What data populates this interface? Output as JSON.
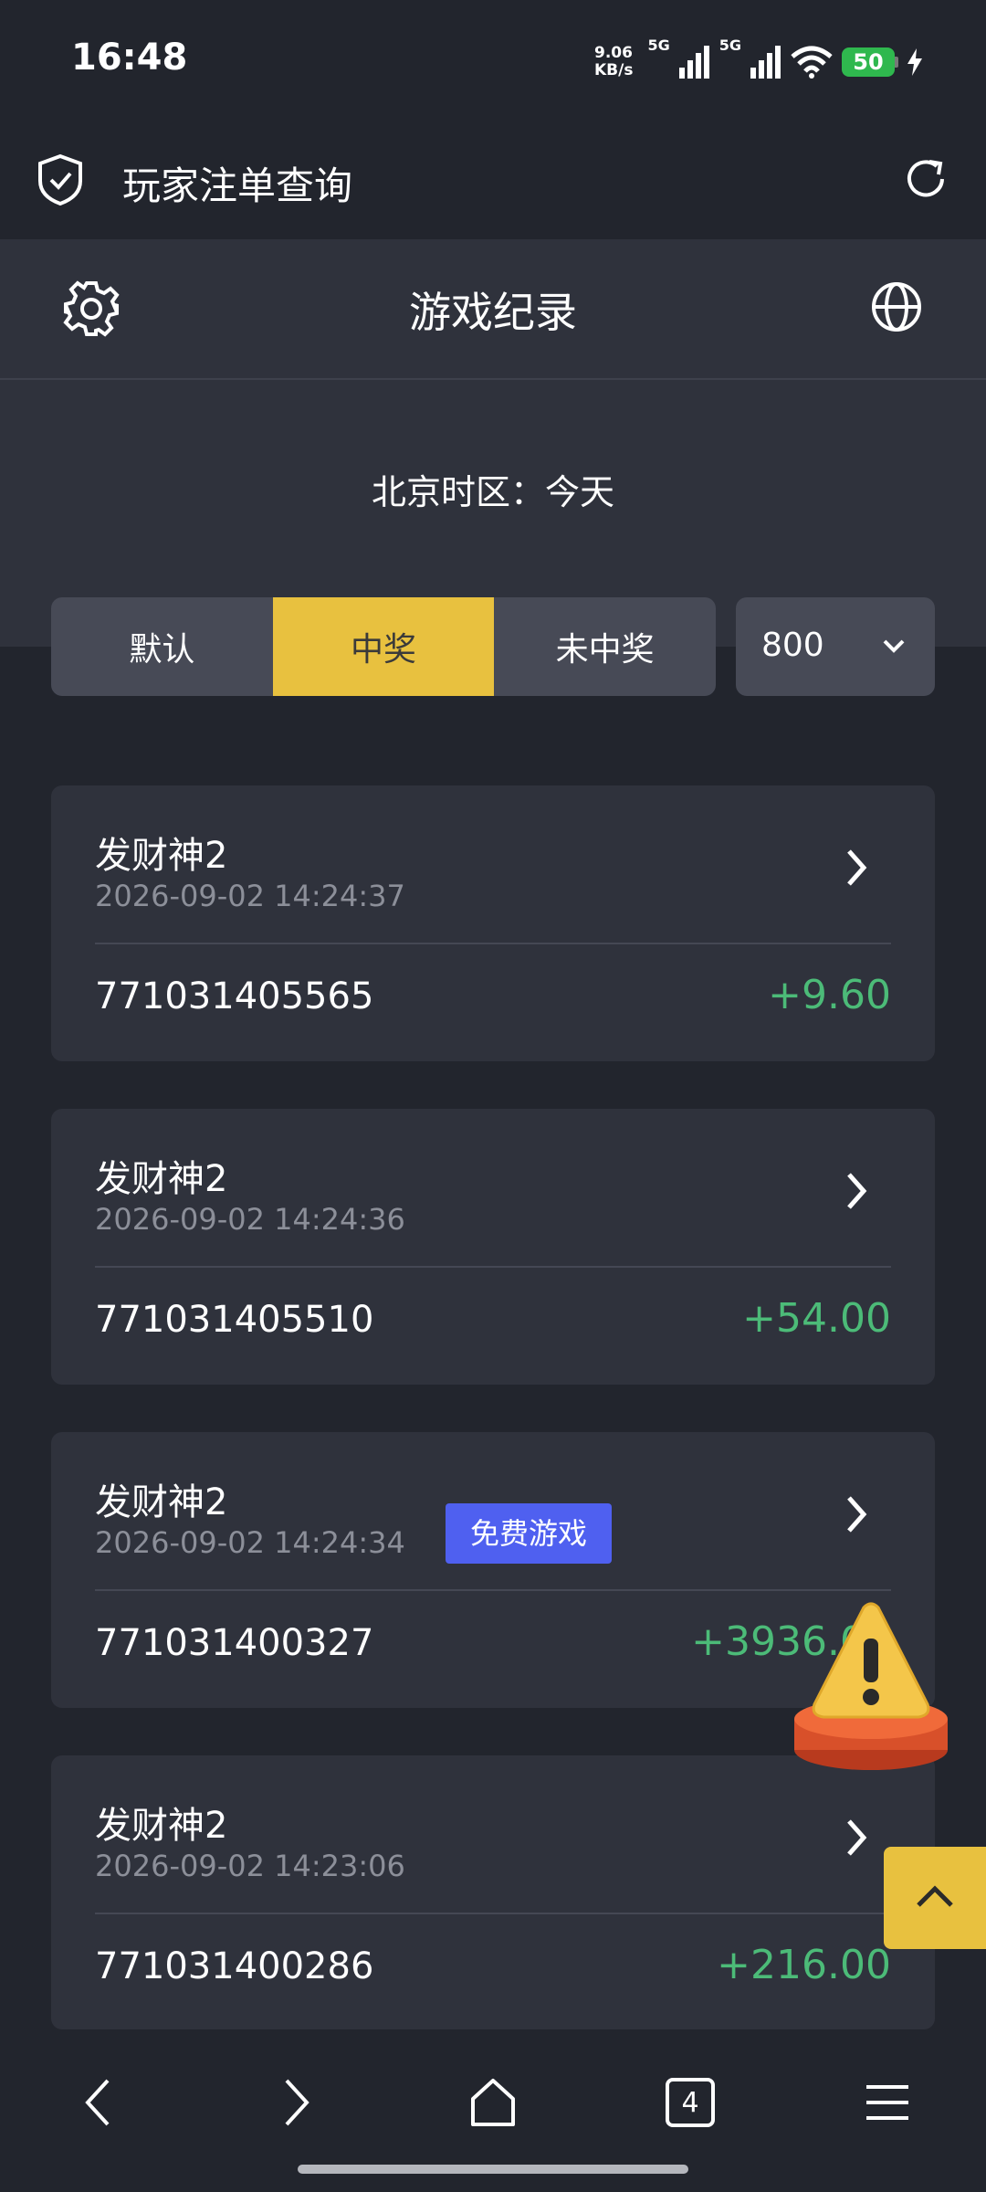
{
  "status_bar": {
    "time": "16:48",
    "net_speed_value": "9.06",
    "net_speed_unit": "KB/s",
    "sim1_tag": "5G",
    "sim2_tag": "5G",
    "battery": "50",
    "battery_color": "#2fb84e"
  },
  "browser": {
    "title": "玩家注单查询"
  },
  "header": {
    "title": "游戏纪录"
  },
  "filter": {
    "timezone_text": "北京时区：今天",
    "tabs": [
      {
        "label": "默认",
        "active": false
      },
      {
        "label": "中奖",
        "active": true
      },
      {
        "label": "未中奖",
        "active": false
      }
    ],
    "page_size": "800",
    "accent_color": "#e8c13f"
  },
  "records": [
    {
      "game": "发财神2",
      "time": "2026-09-02 14:24:37",
      "id": "771031405565",
      "amount": "+9.60"
    },
    {
      "game": "发财神2",
      "time": "2026-09-02 14:24:36",
      "id": "771031405510",
      "amount": "+54.00"
    },
    {
      "game": "发财神2",
      "time": "2026-09-02 14:24:34",
      "id": "771031400327",
      "amount": "+3936.00",
      "badge": "免费游戏"
    },
    {
      "game": "发财神2",
      "time": "2026-09-02 14:23:06",
      "id": "771031400286",
      "amount": "+216.00"
    }
  ],
  "bottom_nav": {
    "tab_count": "4"
  }
}
